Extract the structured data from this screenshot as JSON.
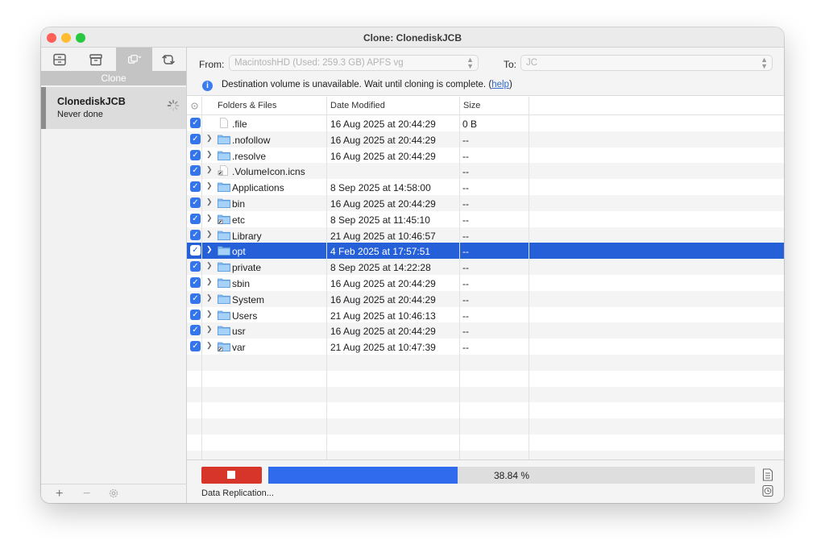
{
  "window": {
    "title": "Clone: ClonediskJCB"
  },
  "sidebar": {
    "tabs": [
      {
        "name": "schedule-icon",
        "active": false
      },
      {
        "name": "archive-icon",
        "active": false
      },
      {
        "name": "clone-icon",
        "active": true
      },
      {
        "name": "sync-icon",
        "active": false
      }
    ],
    "section_label": "Clone",
    "task": {
      "name": "ClonediskJCB",
      "status": "Never done"
    },
    "bottom": {
      "add": "+",
      "remove": "−",
      "settings_icon": "gear-icon"
    }
  },
  "header": {
    "from_label": "From:",
    "from_value": "MacintoshHD (Used: 259.3 GB)  APFS vg",
    "to_label": "To:",
    "to_value": "JC",
    "message": "Destination volume is unavailable. Wait until cloning is complete.",
    "help_open": "(",
    "help_link": "help",
    "help_close": ")"
  },
  "table": {
    "columns": [
      "Folders & Files",
      "Date Modified",
      "Size"
    ],
    "rows": [
      {
        "name": ".file",
        "date": "16 Aug 2025 at 20:44:29",
        "size": "0 B",
        "icon": "file",
        "expandable": false
      },
      {
        "name": ".nofollow",
        "date": "16 Aug 2025 at 20:44:29",
        "size": "--",
        "icon": "folder",
        "expandable": true
      },
      {
        "name": ".resolve",
        "date": "16 Aug 2025 at 20:44:29",
        "size": "--",
        "icon": "folder",
        "expandable": true
      },
      {
        "name": ".VolumeIcon.icns",
        "date": "",
        "size": "--",
        "icon": "image",
        "expandable": true
      },
      {
        "name": "Applications",
        "date": "8 Sep 2025 at 14:58:00",
        "size": "--",
        "icon": "folder",
        "expandable": true
      },
      {
        "name": "bin",
        "date": "16 Aug 2025 at 20:44:29",
        "size": "--",
        "icon": "folder",
        "expandable": true
      },
      {
        "name": "etc",
        "date": "8 Sep 2025 at 11:45:10",
        "size": "--",
        "icon": "alias",
        "expandable": true
      },
      {
        "name": "Library",
        "date": "21 Aug 2025 at 10:46:57",
        "size": "--",
        "icon": "folder",
        "expandable": true
      },
      {
        "name": "opt",
        "date": "4 Feb 2025 at 17:57:51",
        "size": "--",
        "icon": "folder",
        "expandable": true,
        "selected": true
      },
      {
        "name": "private",
        "date": "8 Sep 2025 at 14:22:28",
        "size": "--",
        "icon": "folder",
        "expandable": true
      },
      {
        "name": "sbin",
        "date": "16 Aug 2025 at 20:44:29",
        "size": "--",
        "icon": "folder",
        "expandable": true
      },
      {
        "name": "System",
        "date": "16 Aug 2025 at 20:44:29",
        "size": "--",
        "icon": "folder",
        "expandable": true
      },
      {
        "name": "Users",
        "date": "21 Aug 2025 at 10:46:13",
        "size": "--",
        "icon": "folder",
        "expandable": true
      },
      {
        "name": "usr",
        "date": "16 Aug 2025 at 20:44:29",
        "size": "--",
        "icon": "folder",
        "expandable": true
      },
      {
        "name": "var",
        "date": "21 Aug 2025 at 10:47:39",
        "size": "--",
        "icon": "alias",
        "expandable": true
      }
    ]
  },
  "footer": {
    "progress_percent": 38.84,
    "progress_label": "38.84 %",
    "status": "Data Replication..."
  },
  "colors": {
    "accent": "#2660d8",
    "checkbox": "#3575ec",
    "progress": "#2f6bec",
    "stop": "#d7352a",
    "folder": "#8ec3f5"
  }
}
